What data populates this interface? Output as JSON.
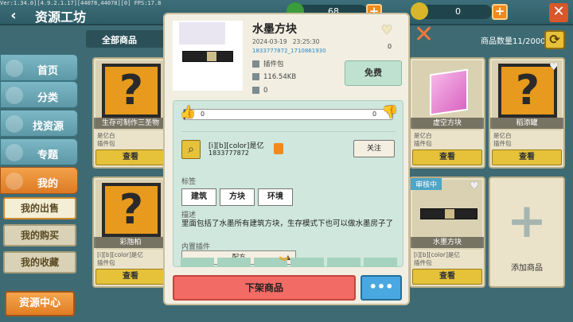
{
  "debug": "Ver:1.34.0][4.9.2.1.17][44078,44078][0] FPS:17.8",
  "header": {
    "title": "资源工坊",
    "back_icon": "back-arrow-icon",
    "beans": "68",
    "coins": "0"
  },
  "sidebar": {
    "items": [
      {
        "label": "首页",
        "icon": "home-icon"
      },
      {
        "label": "分类",
        "icon": "category-icon"
      },
      {
        "label": "找资源",
        "icon": "search-icon"
      },
      {
        "label": "专题",
        "icon": "topic-icon"
      },
      {
        "label": "我的",
        "icon": "user-icon"
      }
    ],
    "sub_items": [
      "我的出售",
      "我的购买",
      "我的收藏"
    ],
    "resource_center": "资源中心"
  },
  "filter": {
    "selected": "全部商品"
  },
  "count": "商品数量11/2000",
  "cards": [
    {
      "name": "生存可制作三圣物",
      "author": "是亿白",
      "type": "插件包",
      "view": "查看"
    },
    {
      "name": "虚空方块",
      "author": "是亿白",
      "type": "插件包",
      "view": "查看"
    },
    {
      "name": "稻添罐",
      "author": "是亿白",
      "type": "插件包",
      "view": "查看"
    },
    {
      "name": "彩虺柏",
      "author": "[i][b][color]是亿",
      "type": "插件包",
      "view": "查看"
    },
    {
      "name": "水墨方块",
      "author": "[i][b][color]是亿",
      "type": "插件包",
      "view": "查看",
      "badge": "审核中"
    }
  ],
  "add_card": "添加商品",
  "modal": {
    "title": "水墨方块",
    "date": "2024-03-19",
    "time": "23:25:30",
    "id": "1833777872_1710861930",
    "type": "插件包",
    "size": "116.54KB",
    "downloads": "0",
    "favorites": "0",
    "price_button": "免费",
    "likes": "0",
    "dislikes": "0",
    "author": {
      "name": "[i][b][color]是亿",
      "id": "1833777872",
      "follow": "关注"
    },
    "tags_label": "标签",
    "tags": [
      "建筑",
      "方块",
      "环境"
    ],
    "desc_label": "描述",
    "description": "里面包括了水墨所有建筑方块，生存模式下也可以做水墨房子了",
    "plugins_label": "内置插件",
    "recipe": "配方",
    "unlist_button": "下架商品",
    "more_button": "•••"
  }
}
